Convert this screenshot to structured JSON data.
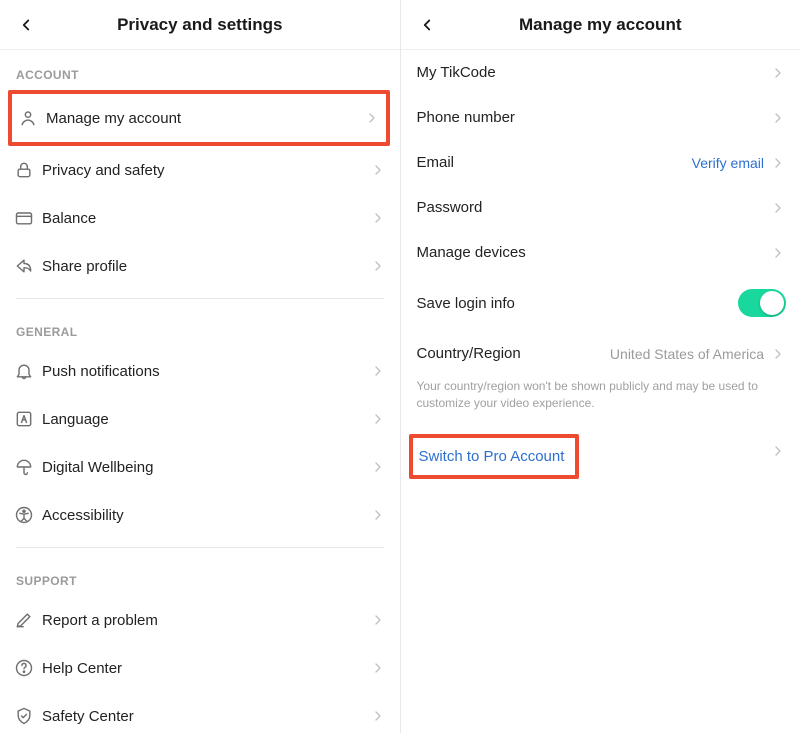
{
  "left": {
    "title": "Privacy and settings",
    "sections": {
      "account": {
        "label": "ACCOUNT",
        "items": {
          "manage": "Manage my account",
          "privacy": "Privacy and safety",
          "balance": "Balance",
          "share": "Share profile"
        }
      },
      "general": {
        "label": "GENERAL",
        "items": {
          "push": "Push notifications",
          "language": "Language",
          "wellbeing": "Digital Wellbeing",
          "accessibility": "Accessibility"
        }
      },
      "support": {
        "label": "SUPPORT",
        "items": {
          "report": "Report a problem",
          "help": "Help Center",
          "safety": "Safety Center"
        }
      }
    }
  },
  "right": {
    "title": "Manage my account",
    "items": {
      "tikcode": "My TikCode",
      "phone": "Phone number",
      "email": {
        "label": "Email",
        "value": "Verify email"
      },
      "password": "Password",
      "devices": "Manage devices",
      "savelogin": "Save login info",
      "country": {
        "label": "Country/Region",
        "value": "United States of America",
        "note": "Your country/region won't be shown publicly and may be used to customize your video experience."
      },
      "switchpro": "Switch to Pro Account"
    }
  }
}
